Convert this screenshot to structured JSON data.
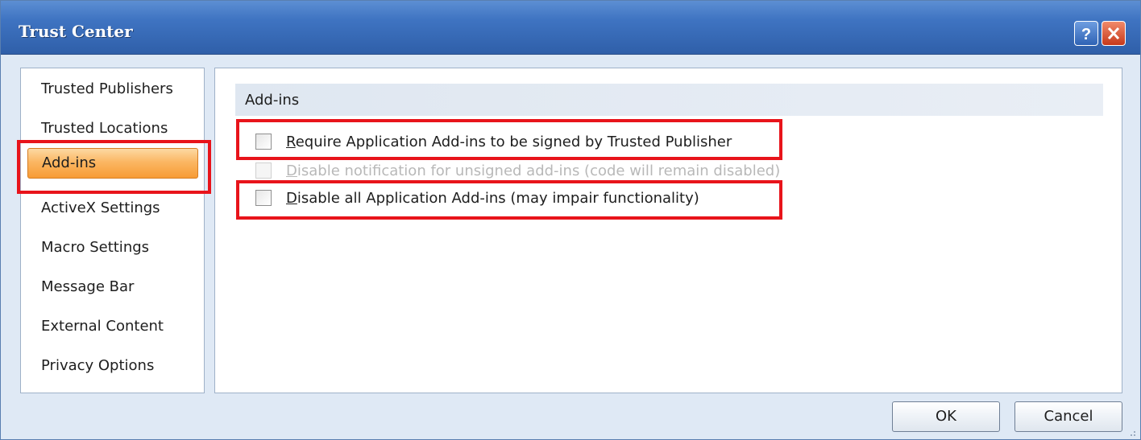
{
  "window": {
    "title": "Trust Center"
  },
  "titlebar_buttons": {
    "help": "?",
    "close": "close"
  },
  "sidebar": {
    "items": [
      {
        "label": "Trusted Publishers"
      },
      {
        "label": "Trusted Locations"
      },
      {
        "label": "Add-ins"
      },
      {
        "label": "ActiveX Settings"
      },
      {
        "label": "Macro Settings"
      },
      {
        "label": "Message Bar"
      },
      {
        "label": "External Content"
      },
      {
        "label": "Privacy Options"
      }
    ],
    "selected": "Add-ins"
  },
  "content": {
    "section_title": "Add-ins",
    "options": [
      {
        "key": "R",
        "label_rest": "equire Application Add-ins to be signed by Trusted Publisher",
        "checked": false,
        "enabled": true
      },
      {
        "key": "D",
        "label_rest": "isable notification for unsigned add-ins (code will remain disabled)",
        "checked": false,
        "enabled": false
      },
      {
        "key": "D",
        "label_rest": "isable all Application Add-ins (may impair functionality)",
        "checked": false,
        "enabled": true
      }
    ]
  },
  "footer": {
    "ok_label": "OK",
    "cancel_label": "Cancel"
  },
  "colors": {
    "highlight": "#e8141b",
    "selected_item": "#f79b35",
    "title_bar": "#3f74c2"
  }
}
